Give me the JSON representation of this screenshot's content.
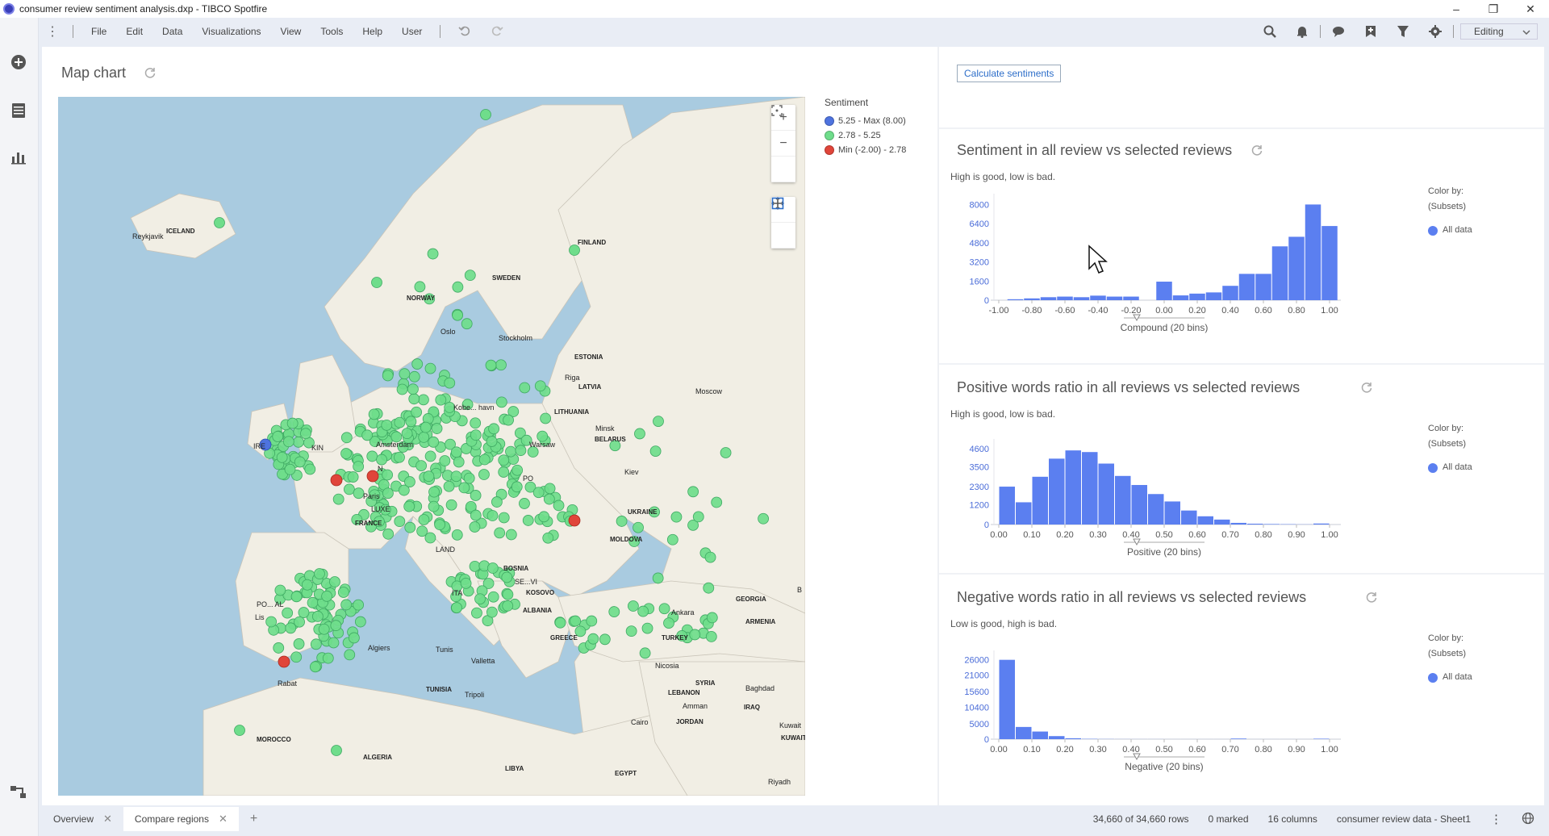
{
  "window": {
    "title": "consumer review sentiment analysis.dxp - TIBCO Spotfire",
    "controls": [
      "–",
      "❐",
      "✕"
    ]
  },
  "menubar": {
    "items": [
      "File",
      "Edit",
      "Data",
      "Visualizations",
      "View",
      "Tools",
      "Help",
      "User"
    ],
    "mode": "Editing"
  },
  "map": {
    "title": "Map chart",
    "legend_title": "Sentiment",
    "legend": [
      {
        "label": "5.25 - Max (8.00)",
        "color": "#4e73df"
      },
      {
        "label": "2.78 - 5.25",
        "color": "#6fdd8b"
      },
      {
        "label": "Min (-2.00) - 2.78",
        "color": "#e0453a"
      }
    ],
    "countries": [
      "ICELAND",
      "FINLAND",
      "SWEDEN",
      "NORWAY",
      "ESTONIA",
      "LATVIA",
      "LITHUANIA",
      "BELARUS",
      "FRANCE",
      "UKRAINE",
      "MOLDOVA",
      "KOSOVO",
      "ALBANIA",
      "GREECE",
      "TURKEY",
      "GEORGIA",
      "ARMENIA",
      "TUNISIA",
      "ALGERIA",
      "MOROCCO",
      "LIBYA",
      "EGYPT",
      "SYRIA",
      "LEBANON",
      "IRAQ",
      "JORDAN",
      "KUWAIT",
      "BOSNIA"
    ],
    "cities": [
      "Reykjavik",
      "Oslo",
      "Stockholm",
      "Riga",
      "Minsk",
      "Warsaw",
      "Kiev",
      "Moscow",
      "Amsterdam",
      "Paris",
      "Algiers",
      "Tunis",
      "Tripoli",
      "Valletta",
      "Rabat",
      "Cairo",
      "Amman",
      "Baghdad",
      "Kuwait",
      "Riyadh",
      "Ankara",
      "Nicosia"
    ],
    "label_fragments": {
      "koben": "Kobe... havn",
      "ire": "IRE",
      "kin": "KIN",
      "pol": "PO",
      "nl": "N",
      "land": "LAND",
      "ita": "ITA",
      "por": "PO... AL",
      "lis": "Lis",
      "lux": "LUXE",
      "bos": "BOSNIA",
      "serv": "SE...VI",
      "b": "B"
    }
  },
  "right": {
    "calc_button": "Calculate sentiments",
    "charts": [
      {
        "title": "Sentiment in all review vs selected reviews",
        "subtitle": "High is good, low is bad.",
        "color_by_label": "Color by:",
        "color_by_value": "(Subsets)",
        "legend_item": "All data",
        "xaxis_title": "Compound (20 bins)"
      },
      {
        "title": "Positive words ratio in all reviews vs selected reviews",
        "subtitle": "High is good, low is bad.",
        "color_by_label": "Color by:",
        "color_by_value": "(Subsets)",
        "legend_item": "All data",
        "xaxis_title": "Positive (20 bins)"
      },
      {
        "title": "Negative words ratio in all reviews vs selected reviews",
        "subtitle": "Low is good, high is bad.",
        "color_by_label": "Color by:",
        "color_by_value": "(Subsets)",
        "legend_item": "All data",
        "xaxis_title": "Negative (20 bins)"
      }
    ]
  },
  "chart_data": [
    {
      "type": "bar",
      "title": "Sentiment in all review vs selected reviews",
      "xlabel": "Compound (20 bins)",
      "ylabel": "",
      "x_ticks": [
        "-1.00",
        "-0.80",
        "-0.60",
        "-0.40",
        "-0.20",
        "0.00",
        "0.20",
        "0.40",
        "0.60",
        "0.80",
        "1.00"
      ],
      "y_ticks": [
        "0",
        "1600",
        "3200",
        "4800",
        "6400",
        "8000"
      ],
      "xlim": [
        -1.0,
        1.0
      ],
      "ylim": [
        0,
        8500
      ],
      "bin_width": 0.1,
      "series": [
        {
          "name": "All data",
          "values": [
            80,
            150,
            250,
            300,
            250,
            380,
            300,
            300,
            1550,
            400,
            550,
            650,
            1200,
            2200,
            2200,
            4500,
            5300,
            8000,
            6200
          ]
        }
      ],
      "bin_starts": [
        -0.95,
        -0.85,
        -0.75,
        -0.65,
        -0.55,
        -0.45,
        -0.35,
        -0.25,
        -0.05,
        0.05,
        0.15,
        0.25,
        0.35,
        0.45,
        0.55,
        0.65,
        0.75,
        0.85,
        0.95
      ],
      "color": "#5b7ff0"
    },
    {
      "type": "bar",
      "title": "Positive words ratio in all reviews vs selected reviews",
      "xlabel": "Positive (20 bins)",
      "ylabel": "",
      "x_ticks": [
        "0.00",
        "0.10",
        "0.20",
        "0.30",
        "0.40",
        "0.50",
        "0.60",
        "0.70",
        "0.80",
        "0.90",
        "1.00"
      ],
      "y_ticks": [
        "0",
        "1200",
        "2300",
        "3500",
        "4600"
      ],
      "xlim": [
        0.0,
        1.0
      ],
      "ylim": [
        0,
        4900
      ],
      "bin_width": 0.05,
      "series": [
        {
          "name": "All data",
          "values": [
            2300,
            1350,
            2900,
            4000,
            4500,
            4400,
            3700,
            2950,
            2400,
            1850,
            1400,
            850,
            500,
            300,
            100,
            50,
            30,
            20,
            10,
            60
          ]
        }
      ],
      "bin_starts": [
        0.0,
        0.05,
        0.1,
        0.15,
        0.2,
        0.25,
        0.3,
        0.35,
        0.4,
        0.45,
        0.5,
        0.55,
        0.6,
        0.65,
        0.7,
        0.75,
        0.8,
        0.85,
        0.9,
        0.95
      ],
      "color": "#5b7ff0"
    },
    {
      "type": "bar",
      "title": "Negative words ratio in all reviews vs selected reviews",
      "xlabel": "Negative (20 bins)",
      "ylabel": "",
      "x_ticks": [
        "0.00",
        "0.10",
        "0.20",
        "0.30",
        "0.40",
        "0.50",
        "0.60",
        "0.70",
        "0.80",
        "0.90",
        "1.00"
      ],
      "y_ticks": [
        "0",
        "5000",
        "10400",
        "15600",
        "21000",
        "26000"
      ],
      "xlim": [
        0.0,
        1.0
      ],
      "ylim": [
        0,
        27500
      ],
      "bin_width": 0.05,
      "series": [
        {
          "name": "All data",
          "values": [
            26000,
            4000,
            2500,
            1000,
            300,
            100,
            50,
            30,
            20,
            20,
            10,
            10,
            10,
            10,
            200,
            10,
            10,
            10,
            10,
            150
          ]
        }
      ],
      "bin_starts": [
        0.0,
        0.05,
        0.1,
        0.15,
        0.2,
        0.25,
        0.3,
        0.35,
        0.4,
        0.45,
        0.5,
        0.55,
        0.6,
        0.65,
        0.7,
        0.75,
        0.8,
        0.85,
        0.9,
        0.95
      ],
      "color": "#5b7ff0"
    }
  ],
  "bottom": {
    "tabs": [
      {
        "label": "Overview",
        "active": false
      },
      {
        "label": "Compare regions",
        "active": true
      }
    ],
    "add_tab": "+",
    "rows": "34,660 of 34,660 rows",
    "marked": "0 marked",
    "columns": "16 columns",
    "table": "consumer review data - Sheet1"
  }
}
